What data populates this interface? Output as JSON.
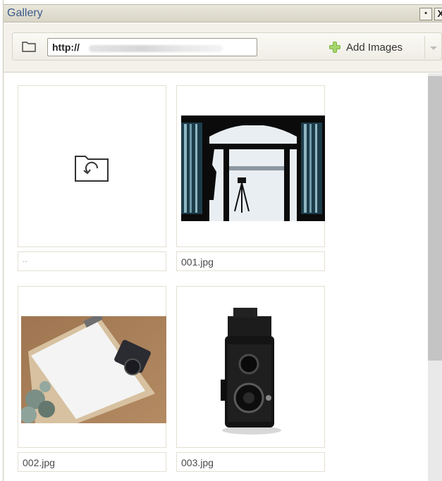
{
  "window": {
    "title": "Gallery",
    "pin_label": "•",
    "close_label": "X"
  },
  "toolbar": {
    "url_value": "http://",
    "add_label": "Add Images"
  },
  "gallery": {
    "items": [
      {
        "caption": "..",
        "type": "parent-folder"
      },
      {
        "caption": "001.jpg",
        "type": "image",
        "subject": "window-silhouette-tripod"
      },
      {
        "caption": "002.jpg",
        "type": "image",
        "subject": "clipboard-camera-desk"
      },
      {
        "caption": "003.jpg",
        "type": "image",
        "subject": "vintage-twin-lens-camera"
      }
    ]
  },
  "colors": {
    "title_text": "#3b5a8a",
    "toolbar_bg": "#f3f1ea",
    "plus_green": "#7cb342"
  }
}
